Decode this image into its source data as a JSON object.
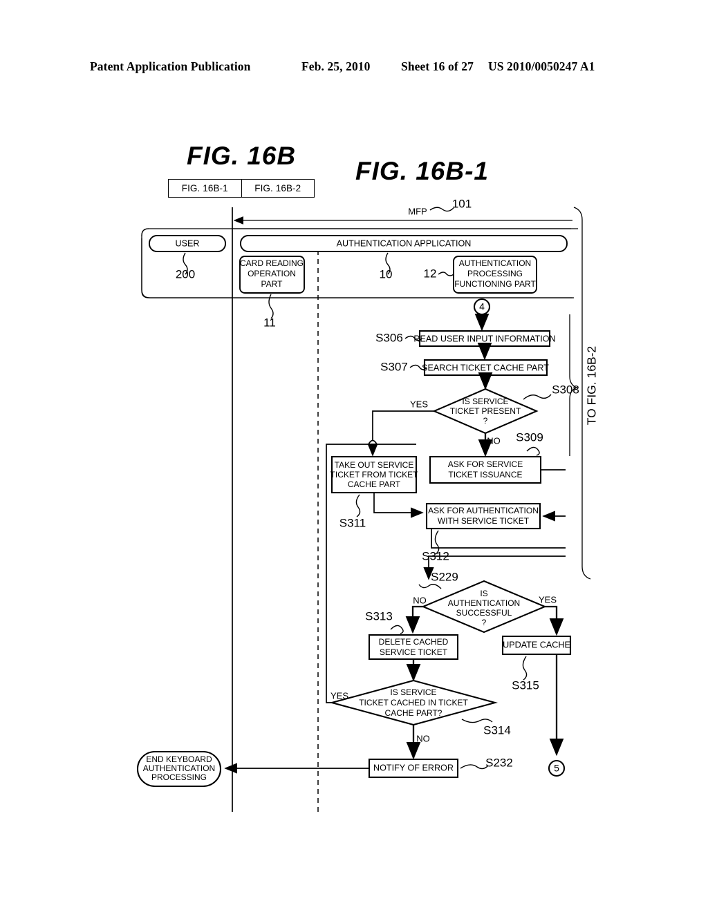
{
  "header": {
    "publication": "Patent Application Publication",
    "date": "Feb. 25, 2010",
    "sheet": "Sheet 16 of 27",
    "patent_number": "US 2010/0050247 A1"
  },
  "figure": {
    "main_title": "FIG.  16B",
    "sub_title": "FIG.  16B-1",
    "key_left": "FIG. 16B-1",
    "key_right": "FIG. 16B-2",
    "continuation_label": "TO FIG. 16B-2"
  },
  "swimlanes": {
    "user": {
      "label": "USER",
      "ref": "200"
    },
    "mfp": {
      "label": "MFP",
      "ref": "101"
    },
    "app": {
      "label": "AUTHENTICATION APPLICATION",
      "ref": "10"
    },
    "card_reader": {
      "label": "CARD READING\nOPERATION\nPART",
      "ref": "11"
    },
    "auth_part": {
      "label": "AUTHENTICATION\nPROCESSING\nFUNCTIONING PART",
      "ref": "12"
    }
  },
  "connectors": [
    {
      "name": "entry",
      "symbol": "4"
    },
    {
      "name": "exit",
      "symbol": "5"
    }
  ],
  "nodes": [
    {
      "id": "S306",
      "step": "S306",
      "type": "process",
      "lines": [
        "READ USER INPUT INFORMATION"
      ]
    },
    {
      "id": "S307",
      "step": "S307",
      "type": "process",
      "lines": [
        "SEARCH TICKET CACHE PART"
      ]
    },
    {
      "id": "S308",
      "step": "S308",
      "type": "decision",
      "lines": [
        "IS SERVICE",
        "TICKET PRESENT",
        "?"
      ]
    },
    {
      "id": "S309",
      "step": "S309",
      "type": "process",
      "lines": [
        "ASK FOR SERVICE",
        "TICKET ISSUANCE"
      ]
    },
    {
      "id": "S311",
      "step": "S311",
      "type": "process",
      "lines": [
        "TAKE OUT SERVICE",
        "TICKET FROM TICKET",
        "CACHE PART"
      ]
    },
    {
      "id": "S312",
      "step": "S312",
      "type": "process",
      "lines": [
        "ASK FOR AUTHENTICATION",
        "WITH SERVICE TICKET"
      ]
    },
    {
      "id": "S229",
      "step": "S229",
      "type": "decision",
      "lines": [
        "IS",
        "AUTHENTICATION",
        "SUCCESSFUL",
        "?"
      ]
    },
    {
      "id": "S313",
      "step": "S313",
      "type": "process",
      "lines": [
        "DELETE CACHED",
        "SERVICE TICKET"
      ]
    },
    {
      "id": "S315",
      "step": "S315",
      "type": "process",
      "lines": [
        "UPDATE CACHE"
      ]
    },
    {
      "id": "S314",
      "step": "S314",
      "type": "decision",
      "lines": [
        "IS SERVICE",
        "TICKET CACHED IN TICKET",
        "CACHE PART?"
      ]
    },
    {
      "id": "S232",
      "step": "S232",
      "type": "process",
      "lines": [
        "NOTIFY OF ERROR"
      ]
    },
    {
      "id": "END",
      "step": "",
      "type": "terminator",
      "lines": [
        "END KEYBOARD",
        "AUTHENTICATION",
        "PROCESSING"
      ]
    }
  ],
  "branch_labels": {
    "s308_yes": "YES",
    "s308_no": "NO",
    "s229_no": "NO",
    "s229_yes": "YES",
    "s314_yes": "YES",
    "s314_no": "NO"
  },
  "node_text": {
    "S306_l1": "READ USER INPUT INFORMATION",
    "S307_l1": "SEARCH TICKET CACHE PART",
    "S308_l1": "IS SERVICE",
    "S308_l2": "TICKET PRESENT",
    "S308_l3": "?",
    "S309_l1": "ASK FOR SERVICE",
    "S309_l2": "TICKET ISSUANCE",
    "S311_l1": "TAKE OUT SERVICE",
    "S311_l2": "TICKET FROM TICKET",
    "S311_l3": "CACHE PART",
    "S312_l1": "ASK FOR AUTHENTICATION",
    "S312_l2": "WITH SERVICE TICKET",
    "S229_l1": "IS",
    "S229_l2": "AUTHENTICATION",
    "S229_l3": "SUCCESSFUL",
    "S229_l4": "?",
    "S313_l1": "DELETE CACHED",
    "S313_l2": "SERVICE TICKET",
    "S315_l1": "UPDATE CACHE",
    "S314_l1": "IS SERVICE",
    "S314_l2": "TICKET CACHED IN TICKET",
    "S314_l3": "CACHE PART?",
    "S232_l1": "NOTIFY OF ERROR",
    "END_l1": "END KEYBOARD",
    "END_l2": "AUTHENTICATION",
    "END_l3": "PROCESSING",
    "CARD_l1": "CARD READING",
    "CARD_l2": "OPERATION",
    "CARD_l3": "PART",
    "AUTH_l1": "AUTHENTICATION",
    "AUTH_l2": "PROCESSING",
    "AUTH_l3": "FUNCTIONING PART"
  },
  "step_labels": {
    "S306": "S306",
    "S307": "S307",
    "S308": "S308",
    "S309": "S309",
    "S311": "S311",
    "S312": "S312",
    "S229": "S229",
    "S313": "S313",
    "S314": "S314",
    "S315": "S315",
    "S232": "S232"
  },
  "ref_labels": {
    "r200": "200",
    "r101": "101",
    "r10": "10",
    "r11": "11",
    "r12": "12"
  }
}
